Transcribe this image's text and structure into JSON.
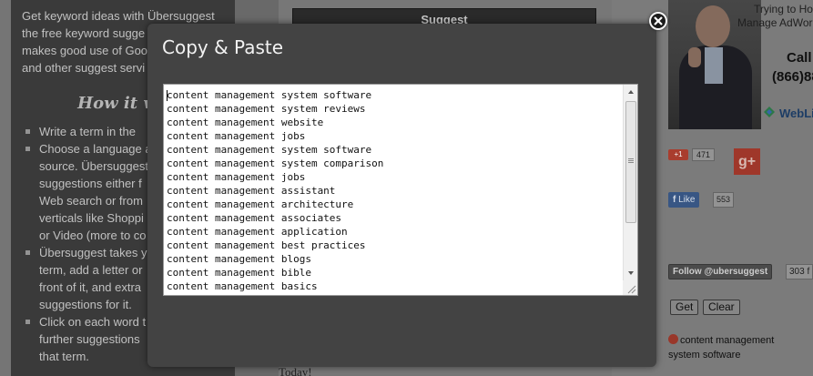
{
  "background": {
    "left_panel": {
      "intro_lines": [
        "Get keyword ideas with Übersuggest",
        "the free keyword sugge",
        "makes good use of Goo",
        "and other suggest servi"
      ],
      "heading": "How it wo",
      "bullets": [
        {
          "lines": [
            "Write a term in the"
          ]
        },
        {
          "lines": [
            "Choose a language a",
            "source. Übersuggest",
            "suggestions either f",
            "Web search or from",
            "verticals like Shoppi",
            "or Video (more to co"
          ]
        },
        {
          "lines": [
            "Übersuggest takes y",
            "term, add a letter or",
            "front of it, and extra",
            "suggestions for it."
          ]
        },
        {
          "lines": [
            "Click on each word t",
            "further suggestions",
            "that term."
          ]
        }
      ]
    },
    "center": {
      "suggest_button": "Suggest",
      "footer_text": "Today!"
    },
    "right_col": {
      "ad_line1": "Trying to Hop",
      "ad_line2": "Manage AdWord",
      "ad_call": "Call",
      "ad_phone": "(866)88",
      "ad_brand": "WebLi",
      "gplus_small_label": "+1",
      "gplus_count": "471",
      "gplus_big_label": "g+",
      "fb_like_label": "Like",
      "fb_count": "553",
      "twitter_follow_label": "Follow @ubersuggest",
      "twitter_count": "303 f",
      "get_button": "Get",
      "clear_button": "Clear",
      "result_text": "content management system software"
    }
  },
  "modal": {
    "title": "Copy & Paste",
    "keywords": [
      "content management system software",
      "content management system reviews",
      "content management website",
      "content management jobs",
      "content management system software",
      "content management system comparison",
      "content management jobs",
      "content management assistant",
      "content management architecture",
      "content management associates",
      "content management application",
      "content management best practices",
      "content management blogs",
      "content management bible",
      "content management basics"
    ]
  },
  "colors": {
    "modal_bg": "#434343",
    "page_dim": "#7a7a7a",
    "left_panel_bg": "#3d3d3d"
  },
  "icons": {
    "close": "close-circle-icon",
    "bullet": "square-bullet-icon",
    "scroll_up": "triangle-up-icon",
    "scroll_down": "triangle-down-icon",
    "resize": "resize-grip-icon"
  }
}
